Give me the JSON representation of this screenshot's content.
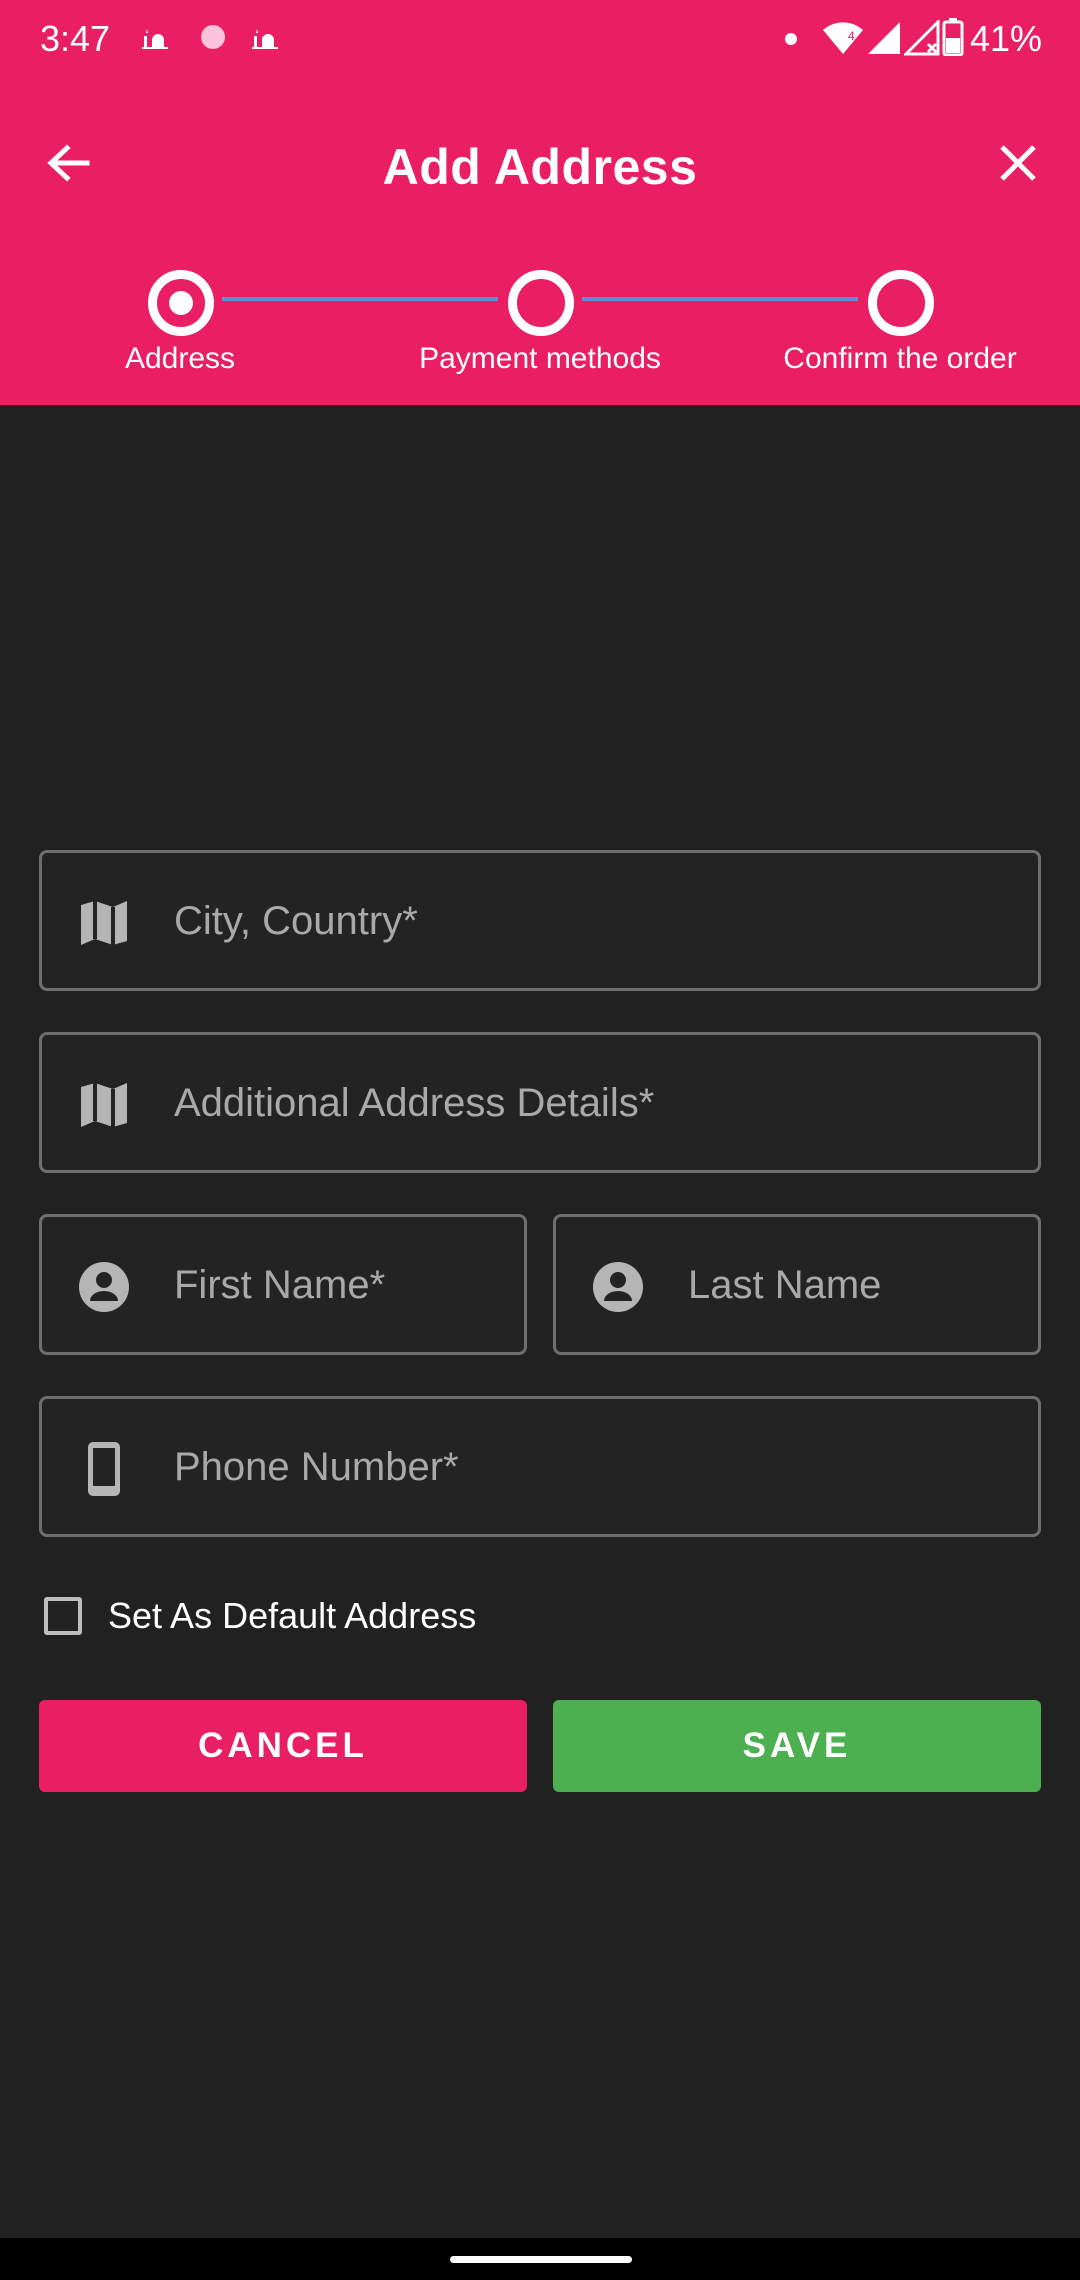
{
  "status_bar": {
    "time": "3:47",
    "battery": "41%",
    "notification_icons": [
      "mosque-icon",
      "record-dot-icon",
      "mosque-icon"
    ],
    "right_icons": [
      "dot-icon",
      "wifi-icon",
      "signal-icon",
      "signal-no-data-icon",
      "battery-icon"
    ]
  },
  "appbar": {
    "title": "Add Address",
    "back_icon": "arrow-back-icon",
    "close_icon": "close-icon"
  },
  "stepper": {
    "steps": [
      {
        "label": "Address",
        "active": true
      },
      {
        "label": "Payment methods",
        "active": false
      },
      {
        "label": "Confirm the order",
        "active": false
      }
    ]
  },
  "form": {
    "city_placeholder": "City, Country*",
    "details_placeholder": "Additional Address Details*",
    "first_name_placeholder": "First Name*",
    "last_name_placeholder": "Last Name",
    "phone_placeholder": "Phone Number*",
    "default_checkbox_label": "Set As Default Address",
    "default_checked": false
  },
  "actions": {
    "cancel_label": "CANCEL",
    "save_label": "SAVE"
  },
  "colors": {
    "primary": "#e91e63",
    "save": "#4caf50",
    "background": "#212121",
    "stepper_line": "#5c8ee0"
  }
}
